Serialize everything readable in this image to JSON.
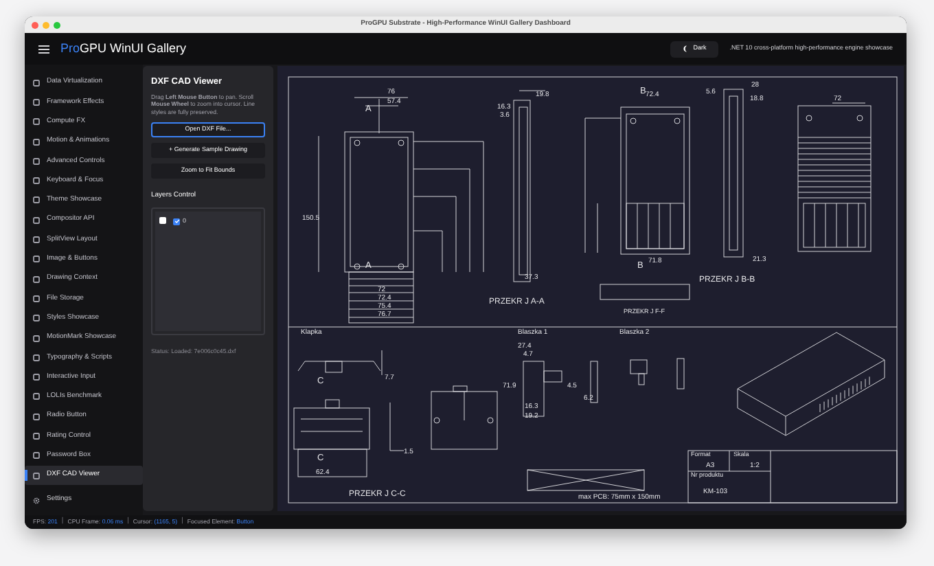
{
  "window": {
    "title": "ProGPU Substrate - High-Performance WinUI Gallery Dashboard"
  },
  "header": {
    "brand_prefix": "Pro",
    "brand": "GPU WinUI Gallery",
    "theme_button": "Dark",
    "tagline": ".NET 10 cross-platform high-performance engine showcase"
  },
  "sidebar": {
    "items": [
      {
        "label": "Data Virtualization",
        "selected": false
      },
      {
        "label": "Framework Effects",
        "selected": false
      },
      {
        "label": "Compute FX",
        "selected": false
      },
      {
        "label": "Motion & Animations",
        "selected": false
      },
      {
        "label": "Advanced Controls",
        "selected": false
      },
      {
        "label": "Keyboard & Focus",
        "selected": false
      },
      {
        "label": "Theme Showcase",
        "selected": false
      },
      {
        "label": "Compositor API",
        "selected": false
      },
      {
        "label": "SplitView Layout",
        "selected": false
      },
      {
        "label": "Image & Buttons",
        "selected": false
      },
      {
        "label": "Drawing Context",
        "selected": false
      },
      {
        "label": "File Storage",
        "selected": false
      },
      {
        "label": "Styles Showcase",
        "selected": false
      },
      {
        "label": "MotionMark Showcase",
        "selected": false
      },
      {
        "label": "Typography & Scripts",
        "selected": false
      },
      {
        "label": "Interactive Input",
        "selected": false
      },
      {
        "label": "LOLIs Benchmark",
        "selected": false
      },
      {
        "label": "Radio Button",
        "selected": false
      },
      {
        "label": "Rating Control",
        "selected": false
      },
      {
        "label": "Password Box",
        "selected": false
      },
      {
        "label": "DXF CAD Viewer",
        "selected": true
      }
    ],
    "footer": "Settings"
  },
  "panel": {
    "title": "DXF CAD Viewer",
    "description": "Drag **Left Mouse Button** to pan. Scroll **Mouse Wheel** to zoom into cursor. Line styles are fully preserved.",
    "buttons": [
      {
        "label": "Open DXF File...",
        "selected": true
      },
      {
        "label": "+ Generate Sample Drawing",
        "selected": false
      },
      {
        "label": "Zoom to Fit Bounds",
        "selected": false
      }
    ],
    "layers_heading": "Layers Control",
    "layers": [
      {
        "checked": false
      },
      {
        "label": "0",
        "checked": true
      }
    ],
    "status": "Status: Loaded: 7e006c0c45.dxf"
  },
  "cad": {
    "labels": [
      {
        "kind": "marker",
        "text": "A"
      },
      {
        "kind": "marker",
        "text": "A"
      },
      {
        "kind": "marker",
        "text": "B"
      },
      {
        "kind": "marker",
        "text": "B"
      },
      {
        "kind": "marker",
        "text": "C"
      },
      {
        "kind": "marker",
        "text": "C"
      },
      {
        "kind": "section",
        "text": "PRZEKR  J A-A"
      },
      {
        "kind": "section",
        "text": "PRZEKR  J B-B"
      },
      {
        "kind": "subsection",
        "text": "PRZEKR  J F-F"
      },
      {
        "kind": "section",
        "text": "PRZEKR  J C-C"
      },
      {
        "kind": "view",
        "text": "Klapka"
      },
      {
        "kind": "view",
        "text": "Blaszka 1"
      },
      {
        "kind": "view",
        "text": "Blaszka 2"
      },
      {
        "kind": "dimension",
        "text": "76"
      },
      {
        "kind": "dimension",
        "text": "57.4"
      },
      {
        "kind": "dimension",
        "text": "150.5"
      },
      {
        "kind": "dimension",
        "text": "72"
      },
      {
        "kind": "dimension",
        "text": "72.4"
      },
      {
        "kind": "dimension",
        "text": "75.4"
      },
      {
        "kind": "dimension",
        "text": "76.7"
      },
      {
        "kind": "dimension",
        "text": "19.8"
      },
      {
        "kind": "dimension",
        "text": "16.3"
      },
      {
        "kind": "dimension",
        "text": "3.6"
      },
      {
        "kind": "dimension",
        "text": "37.3"
      },
      {
        "kind": "dimension",
        "text": "72.4"
      },
      {
        "kind": "dimension",
        "text": "71.8"
      },
      {
        "kind": "dimension",
        "text": "28"
      },
      {
        "kind": "dimension",
        "text": "5.6"
      },
      {
        "kind": "dimension",
        "text": "18.8"
      },
      {
        "kind": "dimension",
        "text": "21.3"
      },
      {
        "kind": "dimension",
        "text": "72"
      },
      {
        "kind": "dimension",
        "text": "27.4"
      },
      {
        "kind": "dimension",
        "text": "4.7"
      },
      {
        "kind": "dimension",
        "text": "4.5"
      },
      {
        "kind": "dimension",
        "text": "6.2"
      },
      {
        "kind": "dimension",
        "text": "16.3"
      },
      {
        "kind": "dimension",
        "text": "19.2"
      },
      {
        "kind": "dimension",
        "text": "71.9"
      },
      {
        "kind": "dimension",
        "text": "62.4"
      },
      {
        "kind": "dimension",
        "text": "1.5"
      },
      {
        "kind": "dimension",
        "text": "7.7"
      },
      {
        "kind": "cell-label",
        "text": "Format"
      },
      {
        "kind": "cell-value",
        "text": "A3"
      },
      {
        "kind": "cell-label",
        "text": "Skala"
      },
      {
        "kind": "cell-value",
        "text": "1:2"
      },
      {
        "kind": "cell-label",
        "text": "Nr produktu"
      },
      {
        "kind": "cell-value",
        "text": "KM-103"
      },
      {
        "kind": "note",
        "text": "max PCB: 75mm x 150mm"
      }
    ]
  },
  "status_bar": {
    "separator": "|",
    "items": [
      {
        "label": "FPS:",
        "value": "201"
      },
      {
        "label": "CPU Frame:",
        "value": "0.06 ms"
      },
      {
        "label": "Cursor:",
        "value": "(1165, 5)"
      },
      {
        "label": "Focused Element:",
        "value": "Button"
      }
    ]
  }
}
